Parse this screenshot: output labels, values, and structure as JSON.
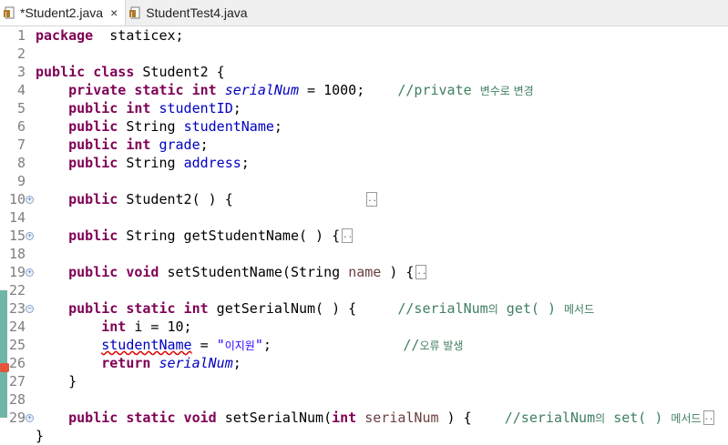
{
  "tabs": [
    {
      "label": "*Student2.java",
      "close": "×"
    },
    {
      "label": "StudentTest4.java"
    }
  ],
  "lines": [
    {
      "num": "1",
      "parts": [
        [
          "kw",
          "package"
        ],
        [
          "",
          "  staticex;"
        ]
      ]
    },
    {
      "num": "2",
      "parts": []
    },
    {
      "num": "3",
      "parts": [
        [
          "kw",
          "public class"
        ],
        [
          "",
          " Student2 {"
        ]
      ]
    },
    {
      "num": "4",
      "parts": [
        [
          "",
          "    "
        ],
        [
          "kw",
          "private static int"
        ],
        [
          "",
          " "
        ],
        [
          "sfld",
          "serialNum"
        ],
        [
          "",
          " = 1000;    "
        ],
        [
          "cm",
          "//private "
        ],
        [
          "cm kor",
          "변수로 변경"
        ]
      ]
    },
    {
      "num": "5",
      "parts": [
        [
          "",
          "    "
        ],
        [
          "kw",
          "public int"
        ],
        [
          "",
          " "
        ],
        [
          "fld",
          "studentID"
        ],
        [
          "",
          ";"
        ]
      ]
    },
    {
      "num": "6",
      "parts": [
        [
          "",
          "    "
        ],
        [
          "kw",
          "public"
        ],
        [
          "",
          " String "
        ],
        [
          "fld",
          "studentName"
        ],
        [
          "",
          ";"
        ]
      ]
    },
    {
      "num": "7",
      "parts": [
        [
          "",
          "    "
        ],
        [
          "kw",
          "public int"
        ],
        [
          "",
          " "
        ],
        [
          "fld",
          "grade"
        ],
        [
          "",
          ";"
        ]
      ]
    },
    {
      "num": "8",
      "parts": [
        [
          "",
          "    "
        ],
        [
          "kw",
          "public"
        ],
        [
          "",
          " String "
        ],
        [
          "fld",
          "address"
        ],
        [
          "",
          ";"
        ]
      ]
    },
    {
      "num": "9",
      "parts": []
    },
    {
      "num": "10",
      "fold": "+",
      "parts": [
        [
          "",
          "    "
        ],
        [
          "kw",
          "public"
        ],
        [
          "",
          " Student2( ) {                "
        ]
      ],
      "collapsed": true
    },
    {
      "num": "14",
      "parts": []
    },
    {
      "num": "15",
      "fold": "+",
      "parts": [
        [
          "",
          "    "
        ],
        [
          "kw",
          "public"
        ],
        [
          "",
          " String getStudentName( ) {"
        ]
      ],
      "collapsed": true
    },
    {
      "num": "18",
      "parts": []
    },
    {
      "num": "19",
      "fold": "+",
      "parts": [
        [
          "",
          "    "
        ],
        [
          "kw",
          "public void"
        ],
        [
          "",
          " setStudentName(String "
        ],
        [
          "var",
          "name"
        ],
        [
          "",
          " ) {"
        ]
      ],
      "collapsed": true
    },
    {
      "num": "22",
      "parts": []
    },
    {
      "num": "23",
      "fold": "−",
      "parts": [
        [
          "",
          "    "
        ],
        [
          "kw",
          "public static int"
        ],
        [
          "",
          " getSerialNum( ) {     "
        ],
        [
          "cm",
          "//serialNum"
        ],
        [
          "cm kor",
          "의"
        ],
        [
          "cm",
          " get( ) "
        ],
        [
          "cm kor",
          "메서드"
        ]
      ]
    },
    {
      "num": "24",
      "parts": [
        [
          "",
          "        "
        ],
        [
          "kw",
          "int"
        ],
        [
          "",
          " i = 10;"
        ]
      ]
    },
    {
      "num": "25",
      "parts": [
        [
          "",
          "        "
        ],
        [
          "fld err",
          "studentName"
        ],
        [
          "",
          " = "
        ],
        [
          "str",
          "\""
        ],
        [
          "str kor",
          "이지원"
        ],
        [
          "str",
          "\""
        ],
        [
          "",
          ";                "
        ],
        [
          "cm",
          "//"
        ],
        [
          "cm kor",
          "오류 발생"
        ]
      ]
    },
    {
      "num": "26",
      "parts": [
        [
          "",
          "        "
        ],
        [
          "kw",
          "return"
        ],
        [
          "",
          " "
        ],
        [
          "sfld",
          "serialNum"
        ],
        [
          "",
          ";"
        ]
      ]
    },
    {
      "num": "27",
      "parts": [
        [
          "",
          "    }"
        ]
      ]
    },
    {
      "num": "28",
      "parts": []
    },
    {
      "num": "29",
      "fold": "+",
      "parts": [
        [
          "",
          "    "
        ],
        [
          "kw",
          "public static void"
        ],
        [
          "",
          " setSerialNum("
        ],
        [
          "kw",
          "int"
        ],
        [
          "",
          " "
        ],
        [
          "var",
          "serialNum"
        ],
        [
          "",
          " ) {    "
        ],
        [
          "cm",
          "//serialNum"
        ],
        [
          "cm kor",
          "의"
        ],
        [
          "cm",
          " set( ) "
        ],
        [
          "cm kor",
          "메서드"
        ]
      ],
      "collapsed": true
    },
    {
      "num": "",
      "parts": [
        [
          "",
          "}"
        ]
      ]
    }
  ]
}
